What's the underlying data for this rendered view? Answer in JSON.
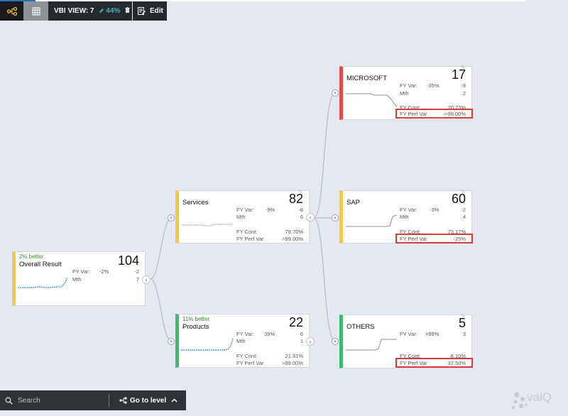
{
  "toolbar": {
    "tree_icon": "tree-view-icon",
    "grid_icon": "grid-view-icon",
    "view_label": "VBI VIEW: 7",
    "zoom": "44%",
    "edit_label": "Edit"
  },
  "colors": {
    "yellow": "#f2c94c",
    "red": "#e84a4a",
    "green": "#3dba72",
    "highlight": "#d93c3c",
    "sparkline": "#2f8dc7"
  },
  "nodes": {
    "overall": {
      "better": "2% better",
      "title": "Overall Result",
      "value": "104",
      "fyvar_label": "FY Var:",
      "fyvar_pct": "-2%",
      "fyvar_abs": "-2",
      "mth_label": "Mth",
      "mth": "7"
    },
    "services": {
      "title": "Services",
      "value": "82",
      "fyvar_label": "FY Var:",
      "fyvar_pct": "-9%",
      "fyvar_abs": "-8",
      "mth_label": "Mth",
      "mth": "6",
      "fycont_label": "FY Cont:",
      "fycont": "78.70%",
      "fyperf_label": "FY Perf Var",
      "fyperf": ">99.00%"
    },
    "products": {
      "better": "11% better",
      "title": "Products",
      "value": "22",
      "fyvar_label": "FY Var:",
      "fyvar_pct": "39%",
      "fyvar_abs": "6",
      "mth_label": "Mth",
      "mth": "1",
      "fycont_label": "FY Cont:",
      "fycont": "21.31%",
      "fyperf_label": "FY Perf Var",
      "fyperf": ">99.00%"
    },
    "microsoft": {
      "title": "MICROSOFT",
      "value": "17",
      "fyvar_label": "FY Var:",
      "fyvar_pct": "-35%",
      "fyvar_abs": "-9",
      "mth_label": "Mth",
      "mth": "2",
      "fycont_label": "FY Cont:",
      "fycont": "20.73%",
      "fyperf_label": "FY Perf Var",
      "fyperf": "->99.00%"
    },
    "sap": {
      "title": "SAP",
      "value": "60",
      "fyvar_label": "FY Var:",
      "fyvar_pct": "-3%",
      "fyvar_abs": "-2",
      "mth_label": "Mth",
      "mth": "4",
      "fycont_label": "FY Cont:",
      "fycont": "73.17%",
      "fyperf_label": "FY Perf Var",
      "fyperf": "-25%"
    },
    "others": {
      "title": "OTHERS",
      "value": "5",
      "fyvar_label": "FY Var:",
      "fyvar_pct": ">99%",
      "fyvar_abs": "3",
      "fycont_label": "FY Cont:",
      "fycont": "6.10%",
      "fyperf_label": "FY Perf Var",
      "fyperf": "37.50%"
    }
  },
  "bottom": {
    "search_placeholder": "Search",
    "go_to_level": "Go to level"
  },
  "brand": {
    "name": "valQ"
  }
}
